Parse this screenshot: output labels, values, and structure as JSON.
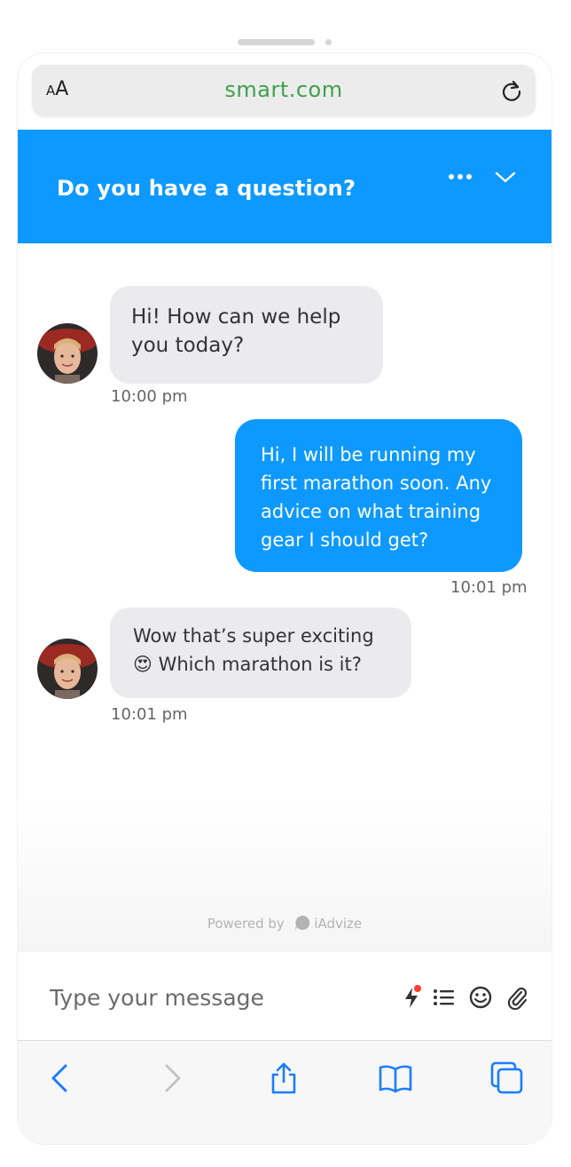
{
  "browser": {
    "text_size_label": "AA",
    "url": "smart.com"
  },
  "chat": {
    "header_title": "Do you have a question?",
    "messages": [
      {
        "sender": "agent",
        "text": "Hi! How can we help you today?",
        "time": "10:00 pm"
      },
      {
        "sender": "user",
        "text": "Hi, I will be running my first marathon soon. Any advice on what training gear I should get?",
        "time": "10:01 pm"
      },
      {
        "sender": "agent",
        "text": "Wow that’s super exciting 😍 Which marathon is it?",
        "time": "10:01 pm"
      }
    ],
    "powered_by": "Powered by",
    "brand": "iAdvize",
    "input_placeholder": "Type your message"
  },
  "colors": {
    "accent": "#0d99ff",
    "url_green": "#3fa14a",
    "agent_bubble": "#ebebed",
    "notification_dot": "#ff3b30"
  },
  "icons": {
    "reload": "reload-icon",
    "more": "more-icon",
    "collapse": "chevron-down-icon",
    "quick": "lightning-icon",
    "list": "list-icon",
    "emoji": "emoji-icon",
    "attach": "paperclip-icon",
    "back": "back-icon",
    "forward": "forward-icon",
    "share": "share-icon",
    "bookmarks": "book-icon",
    "tabs": "tabs-icon"
  }
}
